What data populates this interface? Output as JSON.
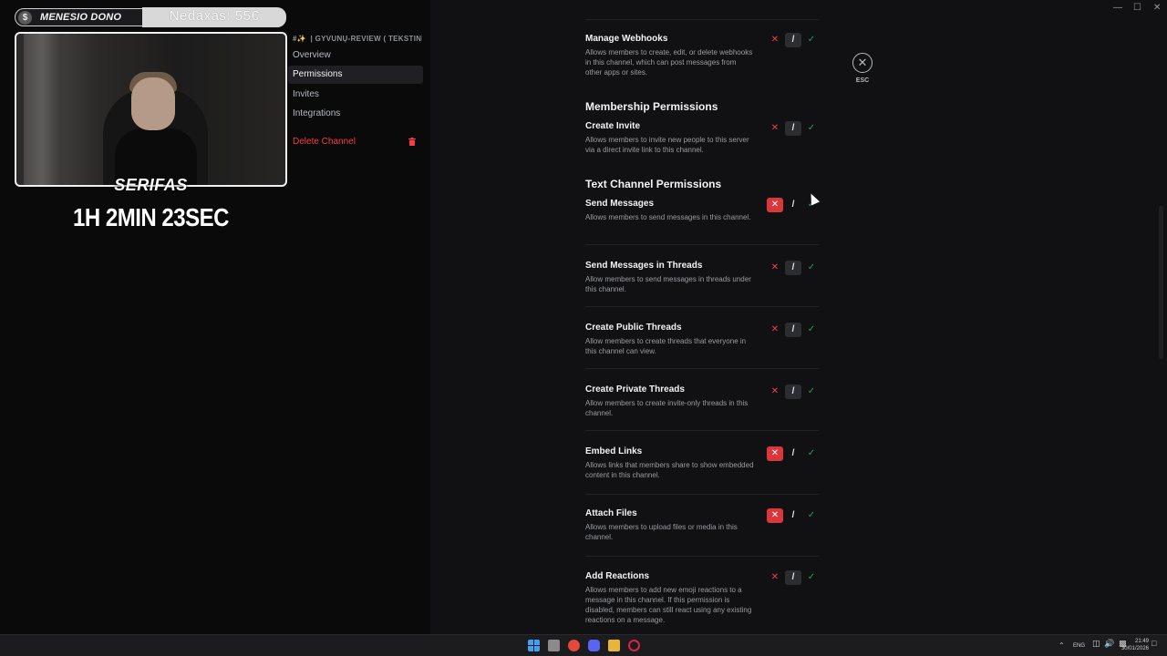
{
  "overlay": {
    "dono_label": "MENESIO DONO",
    "dono_coin": "$",
    "dono_amount": "Nedaxas: 55€",
    "streamer_name": "SERIFAS",
    "timer": "1H 2MIN 23SEC"
  },
  "sidebar": {
    "channel_name": "| gyvunų-review ( tekstini...",
    "channel_icon": "#✨",
    "items": [
      {
        "label": "Overview"
      },
      {
        "label": "Permissions"
      },
      {
        "label": "Invites"
      },
      {
        "label": "Integrations"
      }
    ],
    "delete_label": "Delete Channel"
  },
  "close": {
    "label": "ESC",
    "icon": "✕"
  },
  "sections": {
    "membership": "Membership Permissions",
    "text": "Text Channel Permissions"
  },
  "permissions": [
    {
      "title": "Manage Webhooks",
      "desc": "Allows members to create, edit, or delete webhooks in this channel, which can post messages from other apps or sites.",
      "state": "neutral"
    },
    {
      "title": "Create Invite",
      "desc": "Allows members to invite new people to this server via a direct invite link to this channel.",
      "state": "neutral"
    },
    {
      "title": "Send Messages",
      "desc": "Allows members to send messages in this channel.",
      "state": "deny"
    },
    {
      "title": "Send Messages in Threads",
      "desc": "Allow members to send messages in threads under this channel.",
      "state": "neutral"
    },
    {
      "title": "Create Public Threads",
      "desc": "Allow members to create threads that everyone in this channel can view.",
      "state": "neutral"
    },
    {
      "title": "Create Private Threads",
      "desc": "Allow members to create invite-only threads in this channel.",
      "state": "neutral"
    },
    {
      "title": "Embed Links",
      "desc": "Allows links that members share to show embedded content in this channel.",
      "state": "deny"
    },
    {
      "title": "Attach Files",
      "desc": "Allows members to upload files or media in this channel.",
      "state": "deny"
    },
    {
      "title": "Add Reactions",
      "desc": "Allows members to add new emoji reactions to a message in this channel. If this permission is disabled, members can still react using any existing reactions on a message.",
      "state": "neutral"
    }
  ],
  "toggle_glyphs": {
    "deny": "✕",
    "neutral": "/",
    "allow": "✓"
  },
  "taskbar": {
    "lang": "ENG",
    "time": "21:49",
    "date": "30/01/2026"
  },
  "colors": {
    "deny": "#da373c",
    "allow": "#23a55a",
    "danger_text": "#f23f43"
  }
}
